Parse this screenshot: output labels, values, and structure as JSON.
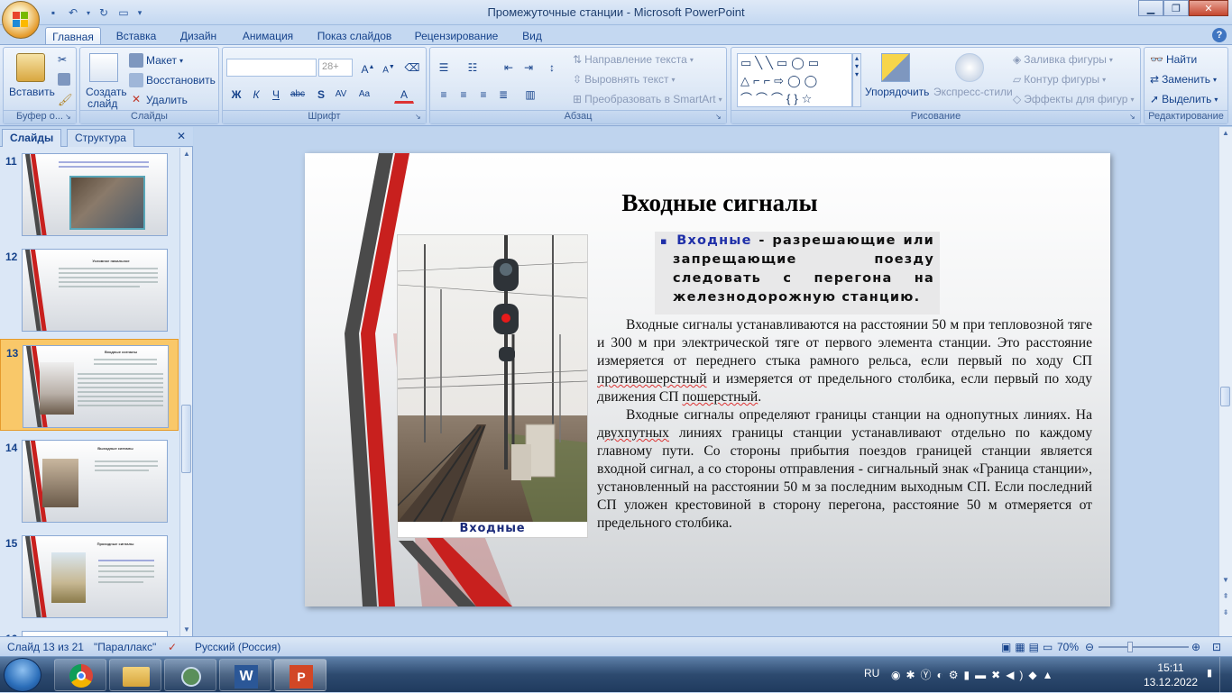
{
  "window": {
    "title": "Промежуточные станции - Microsoft PowerPoint"
  },
  "ribbon": {
    "tabs": [
      "Главная",
      "Вставка",
      "Дизайн",
      "Анимация",
      "Показ слайдов",
      "Рецензирование",
      "Вид"
    ],
    "clipboard": {
      "paste": "Вставить",
      "label": "Буфер о..."
    },
    "slides": {
      "create": "Создать",
      "create2": "слайд",
      "layout": "Макет",
      "reset": "Восстановить",
      "delete": "Удалить",
      "label": "Слайды"
    },
    "font": {
      "size": "28+",
      "label": "Шрифт"
    },
    "paragraph": {
      "text_direction": "Направление текста",
      "align_text": "Выровнять текст",
      "smartart": "Преобразовать в SmartArt",
      "label": "Абзац"
    },
    "drawing": {
      "arrange": "Упорядочить",
      "quick_styles": "Экспресс-стили",
      "fill": "Заливка фигуры",
      "outline": "Контур фигуры",
      "effects": "Эффекты для фигур",
      "label": "Рисование"
    },
    "editing": {
      "find": "Найти",
      "replace": "Заменить",
      "select": "Выделить",
      "label": "Редактирование"
    }
  },
  "panel": {
    "tabs": [
      "Слайды",
      "Структура"
    ],
    "thumbs": [
      {
        "num": "11",
        "title": ""
      },
      {
        "num": "12",
        "title": "Условное начальное"
      },
      {
        "num": "13",
        "title": "Входные сигналы"
      },
      {
        "num": "14",
        "title": "Выходные сигналы"
      },
      {
        "num": "15",
        "title": "Проходные сигналы"
      },
      {
        "num": "16",
        "title": ""
      }
    ]
  },
  "slide": {
    "title": "Входные сигналы",
    "definition_keyword": "Входные",
    "definition_rest": " - разрешающие или запрещающие поезду следовать с перегона на железнодорожную станцию.",
    "photo_caption": "Входные",
    "p1_a": "Входные сигналы устанавливаются на расстоянии 50 м при тепловозной тяге и 300 м при электрической тяге от первого элемента станции. Это расстояние измеряется от переднего стыка рамного рельса, если первый по ходу СП ",
    "p1_b": "противошерстный",
    "p1_c": " и измеряется от предельного столбика, если первый по ходу движения СП ",
    "p1_d": "пошерстный",
    "p1_e": ".",
    "p2_a": "Входные сигналы определяют границы станции на однопутных линиях. На ",
    "p2_b": "двухпутных",
    "p2_c": " линиях границы станции устанавливают отдельно по каждому главному пути. Со стороны прибытия поездов границей станции является входной сигнал, а со стороны отправления - сигнальный знак «Граница станции», установленный на расстоянии 50 м за последним выходным СП. Если последний СП уложен крестовиной в сторону перегона, расстояние 50 м отмеряется от предельного столбика."
  },
  "status": {
    "slide_of": "Слайд 13 из 21",
    "theme": "\"Параллакс\"",
    "language": "Русский (Россия)",
    "zoom": "70%"
  },
  "taskbar": {
    "lang": "RU",
    "time": "15:11",
    "date": "13.12.2022"
  },
  "colors": {
    "accent_red": "#c8201e",
    "accent_gray": "#4a4a4a",
    "keyword_blue": "#1f2fa8"
  }
}
